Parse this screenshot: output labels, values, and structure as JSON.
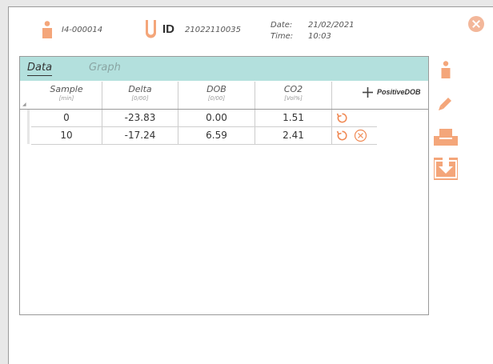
{
  "header": {
    "patient_id": "I4-000014",
    "id_label": "ID",
    "sample_id": "21022110035",
    "date_label": "Date:",
    "date_value": "21/02/2021",
    "time_label": "Time:",
    "time_value": "10:03"
  },
  "tabs": [
    {
      "label": "Data",
      "active": true
    },
    {
      "label": "Graph",
      "active": false
    }
  ],
  "table": {
    "columns": [
      {
        "title": "Sample",
        "unit": "[min]"
      },
      {
        "title": "Delta",
        "unit": "[0/00]"
      },
      {
        "title": "DOB",
        "unit": "[0/00]"
      },
      {
        "title": "CO2",
        "unit": "[Vol%]"
      }
    ],
    "positive_label": "PositiveDOB",
    "rows": [
      {
        "sample": "0",
        "delta": "-23.83",
        "dob": "0.00",
        "co2": "1.51"
      },
      {
        "sample": "10",
        "delta": "-17.24",
        "dob": "6.59",
        "co2": "2.41"
      }
    ]
  },
  "colors": {
    "accent": "#f4a67a",
    "tab_bar": "#b3e0dd",
    "close": "#f3b79a"
  },
  "icons": [
    "patient-icon",
    "sample-tube-icon",
    "close-icon",
    "plus-icon",
    "reset-icon",
    "delete-icon",
    "person-icon",
    "pencil-icon",
    "printer-icon",
    "download-icon"
  ]
}
